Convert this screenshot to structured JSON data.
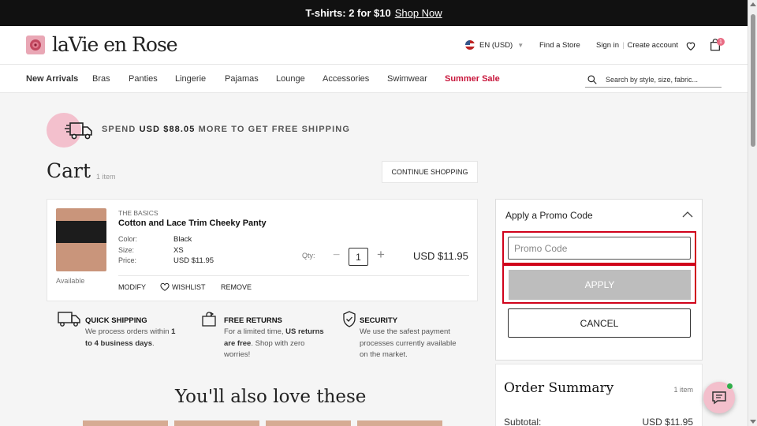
{
  "promo_bar": {
    "text": "T-shirts: 2 for $10",
    "link": "Shop Now"
  },
  "header": {
    "logo": "laVie en Rose",
    "locale": "EN (USD)",
    "find_store": "Find a Store",
    "sign_in": "Sign in",
    "create_account": "Create account",
    "bag_count": "1"
  },
  "nav": {
    "items": [
      "New Arrivals",
      "Bras",
      "Panties",
      "Lingerie",
      "Pajamas",
      "Lounge",
      "Accessories",
      "Swimwear",
      "Summer Sale"
    ],
    "search_placeholder": "Search by style, size, fabric..."
  },
  "shipping": {
    "prefix": "SPEND",
    "amount": "USD $88.05",
    "suffix": "MORE TO GET FREE SHIPPING"
  },
  "cart": {
    "title": "Cart",
    "count": "1 item",
    "continue_label": "CONTINUE SHOPPING",
    "item": {
      "brand": "THE BASICS",
      "name": "Cotton and Lace Trim Cheeky Panty",
      "availability": "Available",
      "attributes": [
        {
          "label": "Color:",
          "value": "Black"
        },
        {
          "label": "Size:",
          "value": "XS"
        },
        {
          "label": "Price:",
          "value": "USD $11.95"
        }
      ],
      "qty_label": "Qty:",
      "qty": "1",
      "minus": "−",
      "plus": "+",
      "total": "USD $11.95",
      "actions": {
        "modify": "MODIFY",
        "wishlist": "WISHLIST",
        "remove": "REMOVE"
      }
    }
  },
  "features": [
    {
      "title": "QUICK SHIPPING",
      "line1": "We process orders within ",
      "bold1": "1",
      "line2_bold": "to 4 business days",
      "line2": ".",
      "icon": "truck-icon"
    },
    {
      "title": "FREE RETURNS",
      "line1": "For a limited time, ",
      "bold1": "US returns",
      "line2_bold": "are free",
      "line2": ". Shop with zero",
      "line3": "worries!",
      "icon": "bag-return-icon"
    },
    {
      "title": "SECURITY",
      "line1": "We use the safest payment",
      "line2": "processes currently available",
      "line3": "on the market.",
      "icon": "shield-icon"
    }
  ],
  "recommendations": {
    "title": "You'll also love these"
  },
  "promo_code": {
    "title": "Apply a Promo Code",
    "placeholder": "Promo Code",
    "apply_label": "APPLY",
    "cancel_label": "CANCEL"
  },
  "order_summary": {
    "title": "Order Summary",
    "count": "1 item",
    "subtotal_label": "Subtotal:",
    "subtotal_value": "USD $11.95"
  },
  "colors": {
    "accent_pink": "#f3c0cd",
    "sale_red": "#c8163b",
    "highlight_red": "#d0021b"
  }
}
